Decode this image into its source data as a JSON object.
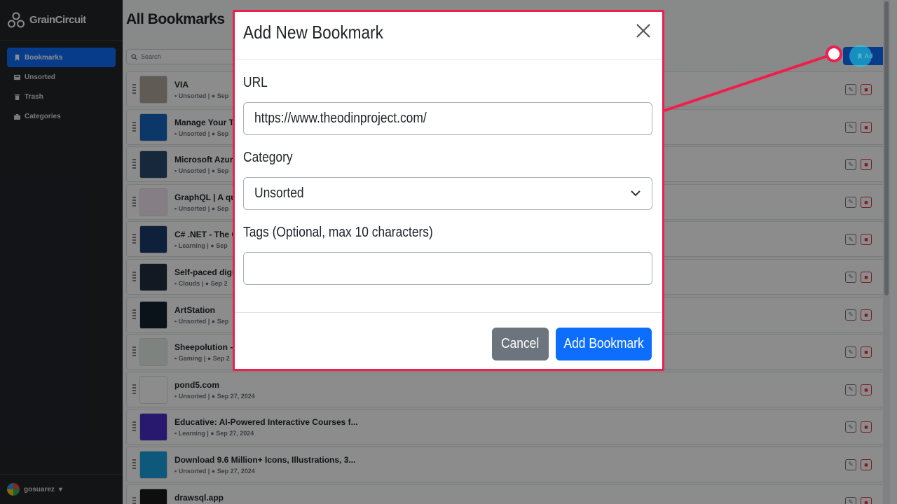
{
  "app": {
    "brand": "GrainCircuit"
  },
  "sidebar": {
    "items": [
      {
        "label": "Bookmarks",
        "active": true,
        "icon": "bookmark-icon"
      },
      {
        "label": "Unsorted",
        "active": false,
        "icon": "inbox-icon"
      },
      {
        "label": "Trash",
        "active": false,
        "icon": "trash-icon"
      },
      {
        "label": "Categories",
        "active": false,
        "icon": "folder-icon"
      }
    ],
    "user": "gosuarez"
  },
  "main": {
    "title": "All Bookmarks",
    "search_placeholder": "Search",
    "add_button": "Ad",
    "rows": [
      {
        "title": "VIA",
        "category": "Unsorted",
        "date": "Sep",
        "thumb_color": "#b0a69c"
      },
      {
        "title": "Manage Your Tea",
        "category": "Unsorted",
        "date": "Sep",
        "thumb_color": "#1565c0"
      },
      {
        "title": "Microsoft Azure",
        "category": "Unsorted",
        "date": "Sep",
        "thumb_color": "#2b4a6f"
      },
      {
        "title": "GraphQL | A quer",
        "category": "Unsorted",
        "date": "Sep",
        "thumb_color": "#f3e5f0"
      },
      {
        "title": "C# .NET - The Co",
        "category": "Learning",
        "date": "Sep",
        "thumb_color": "#1d3b6b"
      },
      {
        "title": "Self-paced digita",
        "category": "Clouds",
        "date": "Sep 2",
        "thumb_color": "#232f3e"
      },
      {
        "title": "ArtStation",
        "category": "Unsorted",
        "date": "Sep",
        "thumb_color": "#13232f"
      },
      {
        "title": "Sheepolution - G",
        "category": "Gaming",
        "date": "Sep 2",
        "thumb_color": "#e8efe8"
      },
      {
        "title": "pond5.com",
        "category": "Unsorted",
        "date": "Sep 27, 2024",
        "thumb_color": "#ffffff"
      },
      {
        "title": "Educative: AI-Powered Interactive Courses f...",
        "category": "Learning",
        "date": "Sep 27, 2024",
        "thumb_color": "#4b2fc9"
      },
      {
        "title": "Download 9.6 Million+ Icons, Illustrations, 3...",
        "category": "Unsorted",
        "date": "Sep 27, 2024",
        "thumb_color": "#1ba3e0"
      },
      {
        "title": "drawsql.app",
        "category": "Unsorted",
        "date": "Sep 27, 2024",
        "thumb_color": "#1a1a1a"
      }
    ]
  },
  "modal": {
    "title": "Add New Bookmark",
    "url_label": "URL",
    "url_value": "https://www.theodinproject.com/",
    "category_label": "Category",
    "category_value": "Unsorted",
    "tags_label": "Tags (Optional, max 10 characters)",
    "tags_value": "",
    "cancel_label": "Cancel",
    "submit_label": "Add Bookmark"
  },
  "colors": {
    "accent": "#0d6efd",
    "highlight": "#ee1f4c",
    "cancel": "#6c757d",
    "sidebar": "#212529"
  }
}
